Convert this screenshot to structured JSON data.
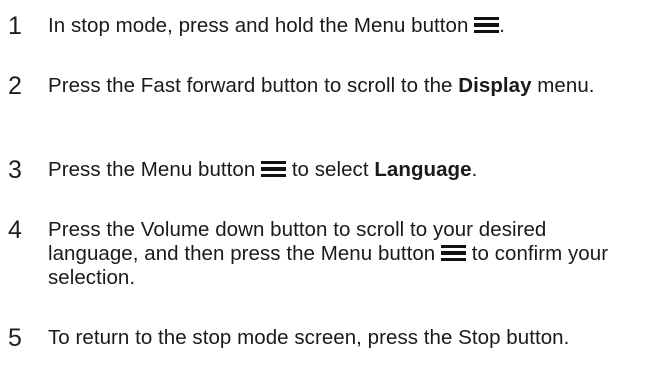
{
  "steps": [
    {
      "number": "1",
      "text_before": "In stop mode, press and hold the Menu button",
      "icon": "menu-icon",
      "text_after": "."
    },
    {
      "number": "2",
      "text_before": "Press the Fast forward button to scroll to the",
      "bold": "Display",
      "text_after": "menu."
    },
    {
      "number": "3",
      "text_before": "Press the Menu button",
      "icon": "menu-icon",
      "text_middle": "to select",
      "bold": "Language",
      "text_after": "."
    },
    {
      "number": "4",
      "text_before": "Press the Volume down button to scroll to your desired language, and then press the Menu button",
      "icon": "menu-icon",
      "text_after": "to confirm your selection."
    },
    {
      "number": "5",
      "text_before": "To return to the stop mode screen, press the Stop button."
    }
  ]
}
